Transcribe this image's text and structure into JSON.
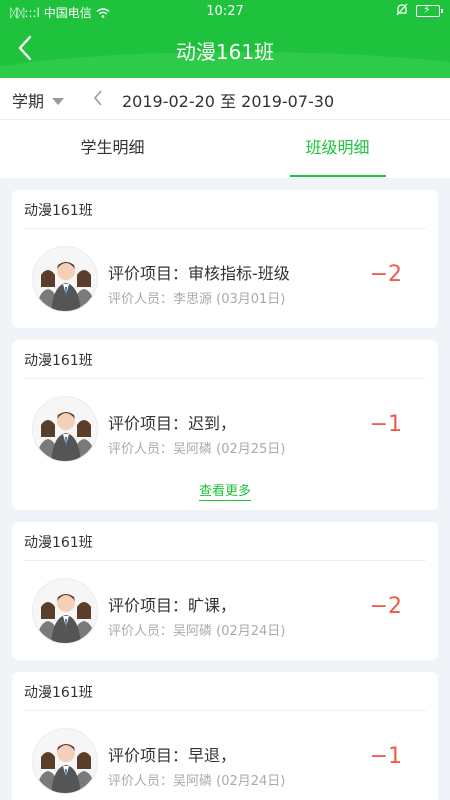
{
  "status": {
    "carrier": "中国电信",
    "signal_text": "ᛞᛞ:::l",
    "time": "10:27"
  },
  "header": {
    "title": "动漫161班",
    "back_icon": "chevron-left-icon"
  },
  "filter": {
    "semester_label": "学期",
    "date_range": "2019-02-20 至 2019-07-30"
  },
  "tabs": [
    {
      "label": "学生明细",
      "active": false
    },
    {
      "label": "班级明细",
      "active": true
    }
  ],
  "colors": {
    "accent": "#1fc23c",
    "score": "#f05a4a"
  },
  "cards": [
    {
      "class_name": "动漫161班",
      "item": "评价项目：审核指标-班级",
      "evaluator": "评价人员：李思源 (03月01日)",
      "score": "−2"
    },
    {
      "class_name": "动漫161班",
      "item": "评价项目：迟到，",
      "evaluator": "评价人员：吴阿磷 (02月25日)",
      "score": "−1",
      "see_more": "查看更多"
    },
    {
      "class_name": "动漫161班",
      "item": "评价项目：旷课，",
      "evaluator": "评价人员：吴阿磷 (02月24日)",
      "score": "−2"
    },
    {
      "class_name": "动漫161班",
      "item": "评价项目：早退，",
      "evaluator": "评价人员：吴阿磷 (02月24日)",
      "score": "−1"
    }
  ]
}
